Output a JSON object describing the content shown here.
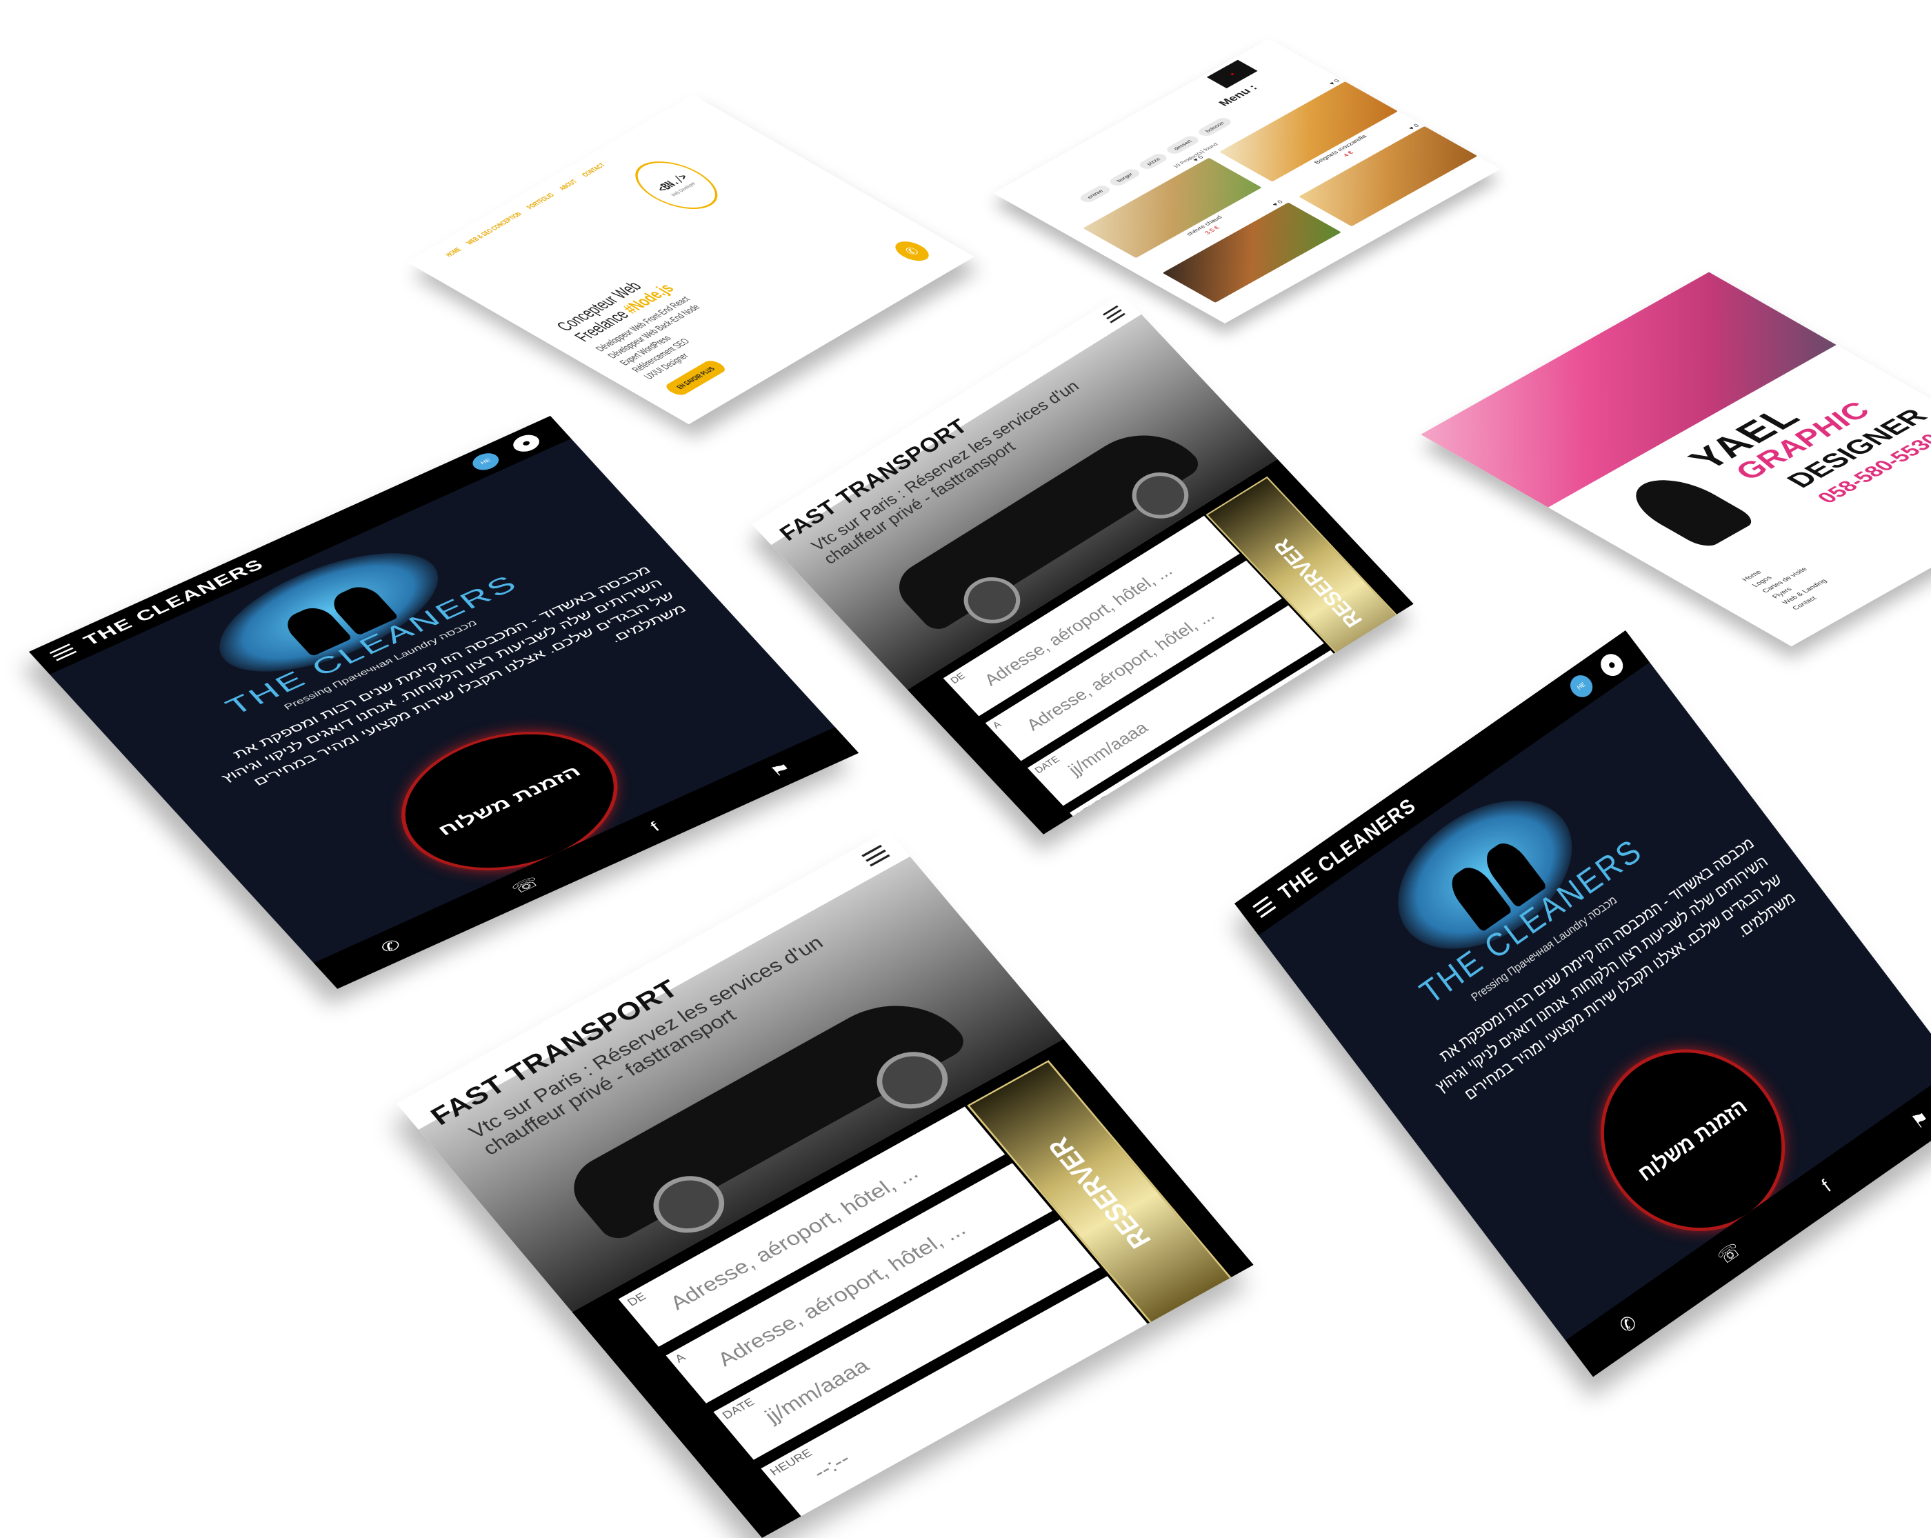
{
  "portfolio": {
    "nav": [
      "HOME",
      "WEB & SEO CONCEPTION",
      "PORTFOLIO",
      "ABOUT",
      "CONTACT"
    ],
    "logo_text": "<BN./>",
    "logo_subtitle": "Web Developer",
    "title_line1": "Concepteur Web",
    "title_line2": "Freelance",
    "title_accent": "#Node.js",
    "skills": [
      "Développeur Web Front-End React",
      "Développeur Web Back-End Node",
      "Expert WordPress",
      "Référencement SEO",
      "UX/UI Designer"
    ],
    "cta_label": "EN SAVOIR PLUS",
    "chat_icon": "whatsapp-icon"
  },
  "food": {
    "menu_label": "Menu :",
    "categories": [
      "entree",
      "burger",
      "pizza",
      "dessert",
      "boisson"
    ],
    "products_count": "15 Product(s) found",
    "items": [
      {
        "name": "chèvre chaud",
        "price": "3.5 €",
        "likes": "0"
      },
      {
        "name": "Beignets mozzarella",
        "price": "4 €",
        "likes": "0"
      },
      {
        "name": "",
        "price": "",
        "likes": "0"
      },
      {
        "name": "",
        "price": "",
        "likes": "0"
      }
    ]
  },
  "designer": {
    "name": "YAEL",
    "graphic": "GRAPHIC",
    "role": "DESIGNER",
    "phone": "058-580-5530",
    "nav": [
      "Home",
      "Logos",
      "Cartes de visite",
      "Flyers",
      "Web & Landing",
      "Contact"
    ]
  },
  "cleaners": {
    "title": "THE CLEANERS",
    "lang": "HE",
    "brand": "THE CLEANERS",
    "subtitle": "Pressing  Прачечная  Laundry  מכבסה",
    "text": "מכבסה באשדוד - המכבסה הזו קיימת שנים רבות ומספקת את השירותים שלה לשביעות רצון הלקוחות. אנחנו דואגים לניקוי וגיהוץ של הבגדים שלכם. אצלנו תקבלו שירות מקצועי ומהיר במחירים משתלמים.",
    "cta_label": "הזמנת משלוח"
  },
  "transport": {
    "title": "FAST TRANSPORT",
    "subtitle": "Vtc sur Paris : Réservez les services d'un chauffeur privé - fasttransport",
    "fields": [
      {
        "label": "DE",
        "placeholder": "Adresse, aéroport, hôtel, ..."
      },
      {
        "label": "A",
        "placeholder": "Adresse, aéroport, hôtel, ..."
      },
      {
        "label": "DATE",
        "placeholder": "jj/mm/aaaa"
      },
      {
        "label": "HEURE",
        "placeholder": "--:--"
      }
    ],
    "button_label": "RESERVER"
  }
}
